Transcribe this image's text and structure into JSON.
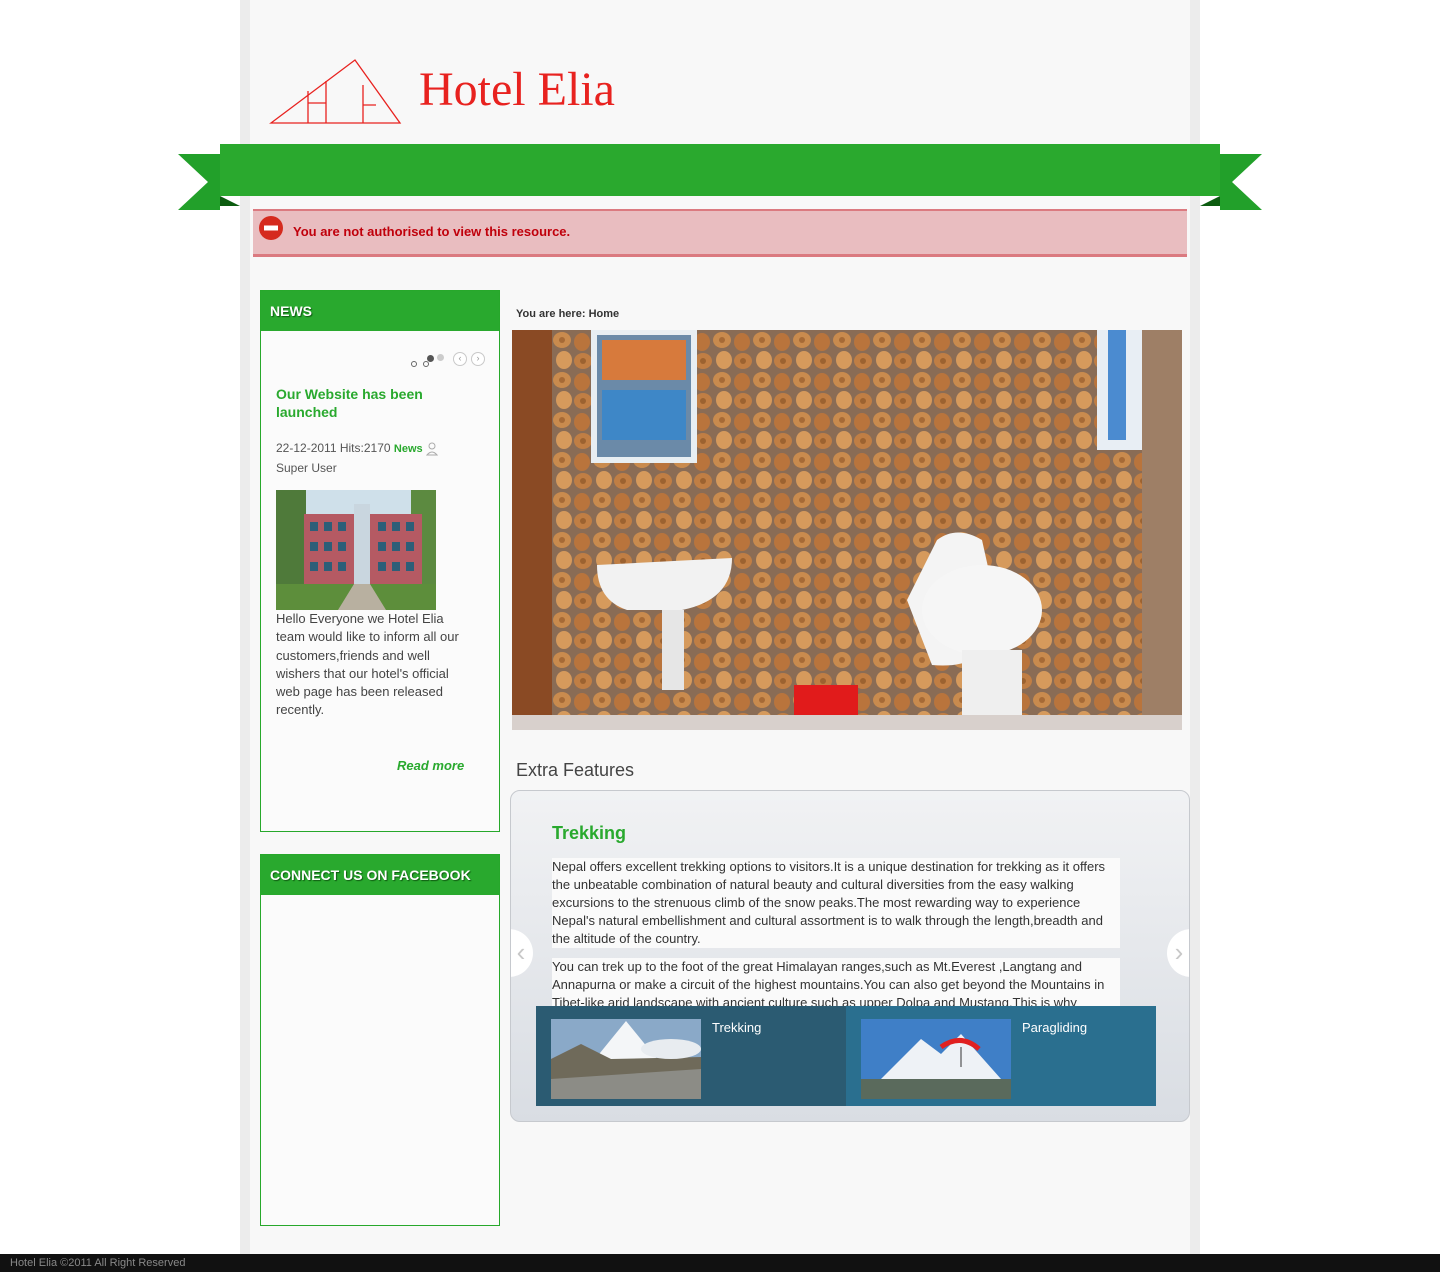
{
  "header": {
    "site_title": "Hotel Elia"
  },
  "alert": {
    "message": "You are not authorised to view this resource."
  },
  "news_module": {
    "heading": "NEWS",
    "article": {
      "title": "Our Website has been launched",
      "date": "22-12-2011",
      "hits": "Hits:2170",
      "category": "News",
      "author": "Super User",
      "body": "Hello Everyone we Hotel Elia team would like to inform all our customers,friends and well wishers that our hotel's official web page has been released recently.",
      "read_more": "Read more"
    }
  },
  "facebook_module": {
    "heading": "CONNECT US ON FACEBOOK"
  },
  "breadcrumb": {
    "text": "You are here:",
    "current": "Home"
  },
  "extra_features": {
    "title": "Extra Features",
    "active": {
      "title": "Trekking",
      "paragraph1": "Nepal offers excellent trekking options to visitors.It is a unique destination for trekking as it offers the unbeatable combination of natural beauty and cultural diversities from the easy walking excursions to the strenuous climb of the snow peaks.The most rewarding way to experience Nepal's natural embellishment and cultural assortment is to walk through the length,breadth and the altitude of the country.",
      "paragraph2": "You can trek up to the foot of the great Himalayan ranges,such as Mt.Everest ,Langtang and Annapurna or make a circuit of the highest mountains.You can also get beyond the Mountains in Tibet-like arid landscape with ancient culture such as upper Dolpa and Mustang.This is why"
    },
    "prev_label": "‹",
    "next_label": "›",
    "thumbs": [
      {
        "label": "Trekking"
      },
      {
        "label": "Paragliding"
      }
    ]
  },
  "footer": {
    "text": "Hotel Elia ©2011 All Right Reserved"
  },
  "colors": {
    "brand_green": "#29a92e",
    "title_red": "#e8221f",
    "alert_bg": "#e9bdc0",
    "alert_text": "#c0000b"
  }
}
